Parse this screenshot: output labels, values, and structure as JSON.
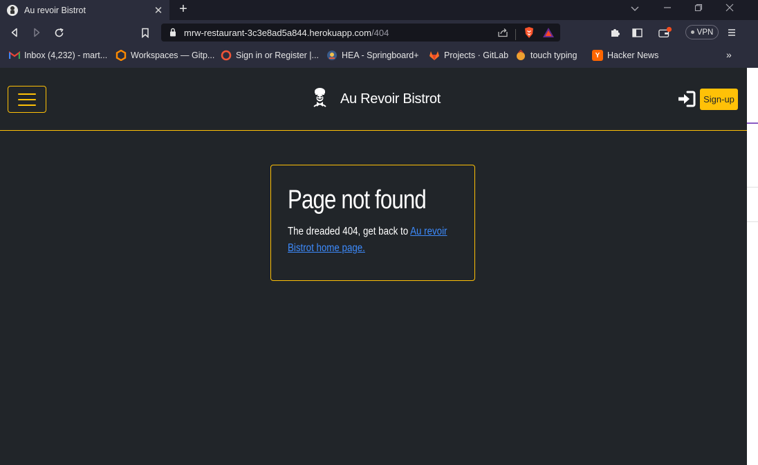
{
  "browser": {
    "tab_title": "Au revoir Bistrot",
    "url_host": "mrw-restaurant-3c3e8ad5a844.herokuapp.com",
    "url_path": "/404",
    "vpn_label": "VPN",
    "bookmarks": [
      {
        "label": "Inbox (4,232) - mart...",
        "icon": "gmail-icon",
        "color": "#ea4335"
      },
      {
        "label": "Workspaces — Gitp...",
        "icon": "gitpod-icon",
        "color": "#ff8a00"
      },
      {
        "label": "Sign in or Register |...",
        "icon": "eventbrite-icon",
        "color": "#f05537"
      },
      {
        "label": "HEA - Springboard+",
        "icon": "springboard-icon",
        "color": "#3a7bd5"
      },
      {
        "label": "Projects · GitLab",
        "icon": "gitlab-icon",
        "color": "#fc6d26"
      },
      {
        "label": "touch typing",
        "icon": "typing-icon",
        "color": "#f0a030"
      },
      {
        "label": "Hacker News",
        "icon": "hackernews-icon",
        "color": "#ff6600"
      }
    ]
  },
  "navbar": {
    "brand_name": "Au Revoir Bistrot",
    "signup_label": "Sign-up"
  },
  "content": {
    "title": "Page not found",
    "text_prefix": "The dreaded 404, get back to ",
    "link_text": "Au revoir Bistrot home page."
  },
  "colors": {
    "accent": "#ffc107",
    "background": "#212529",
    "link": "#3d8bfd"
  }
}
